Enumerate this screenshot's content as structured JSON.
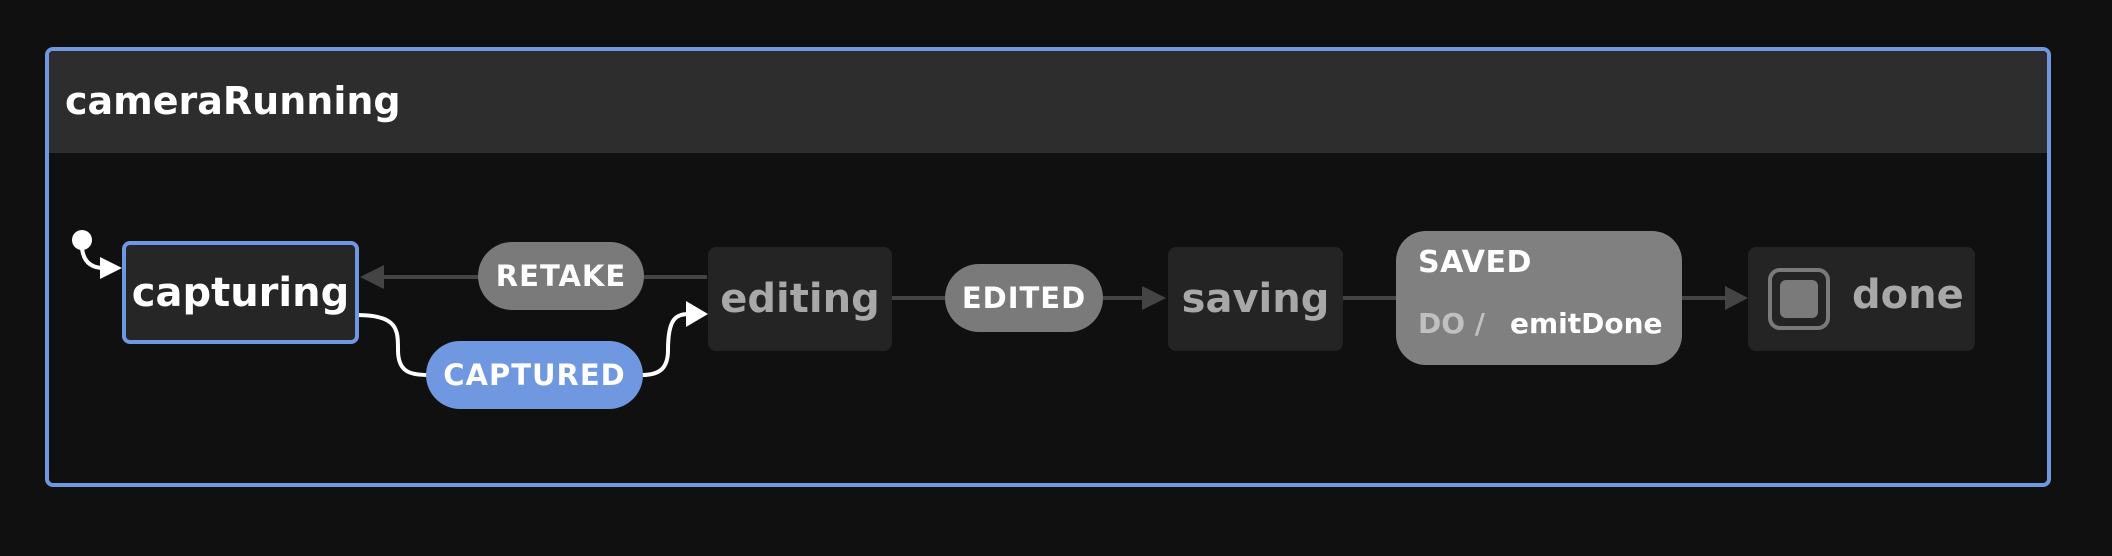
{
  "machine": {
    "title": "cameraRunning"
  },
  "states": {
    "capturing": "capturing",
    "editing": "editing",
    "saving": "saving",
    "done": "done"
  },
  "events": {
    "retake": "RETAKE",
    "captured": "CAPTURED",
    "edited": "EDITED",
    "saved": {
      "label": "SAVED",
      "do_label": "DO /",
      "action": "emitDone"
    }
  },
  "colors": {
    "accent": "#6f98e0",
    "inactive_event": "#7a7a7a",
    "edge": "#444444",
    "header": "#2d2d2d",
    "background": "#101010"
  }
}
